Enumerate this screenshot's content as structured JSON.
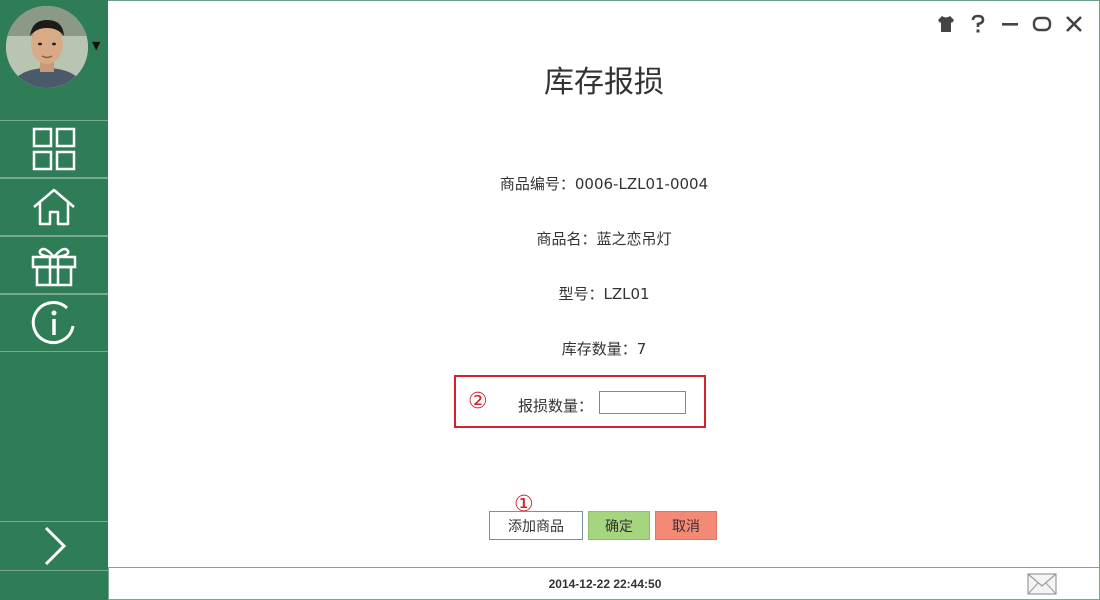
{
  "window": {
    "controls": [
      "skin-icon",
      "help-icon",
      "minimize-icon",
      "maximize-icon",
      "close-icon"
    ]
  },
  "sidebar": {
    "avatar": "user-avatar",
    "items": [
      {
        "icon": "dashboard-grid-icon"
      },
      {
        "icon": "home-icon"
      },
      {
        "icon": "gift-icon"
      },
      {
        "icon": "info-icon"
      }
    ],
    "expand": {
      "icon": "chevron-right-icon"
    }
  },
  "main": {
    "title": "库存报损",
    "fields": [
      {
        "label": "商品编号：",
        "value": "0006-LZL01-0004"
      },
      {
        "label": "商品名：",
        "value": "蓝之恋吊灯"
      },
      {
        "label": "型号：",
        "value": "LZL01"
      },
      {
        "label": "库存数量：",
        "value": "7"
      }
    ],
    "loss_quantity": {
      "label": "报损数量：",
      "value": "",
      "marker": "②"
    },
    "add_marker": "①",
    "buttons": {
      "add": "添加商品",
      "ok": "确定",
      "cancel": "取消"
    }
  },
  "status_bar": {
    "datetime": "2014-12-22 22:44:50",
    "mail_icon": "mail-icon"
  },
  "colors": {
    "sidebar": "#2f7d57",
    "highlight": "#d2232a",
    "ok_button": "#a5d57e",
    "cancel_button": "#f48a76"
  }
}
